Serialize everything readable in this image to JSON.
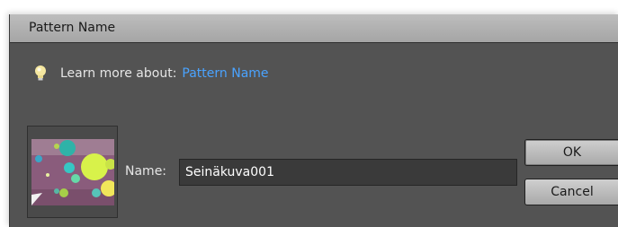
{
  "dialog": {
    "title": "Pattern Name",
    "help": {
      "icon": "lightbulb-icon",
      "prefix": "Learn more about:",
      "link_text": "Pattern Name",
      "link_color": "#4aa3ff"
    },
    "preview": {
      "alt": "pattern-thumbnail"
    },
    "name_field": {
      "label": "Name:",
      "value": "Seinäkuva001"
    },
    "buttons": {
      "ok": "OK",
      "cancel": "Cancel"
    }
  },
  "colors": {
    "dialog_bg": "#535353",
    "titlebar_bg": "#b3b3b3",
    "input_bg": "#3a3a3a",
    "link": "#4aa3ff"
  }
}
